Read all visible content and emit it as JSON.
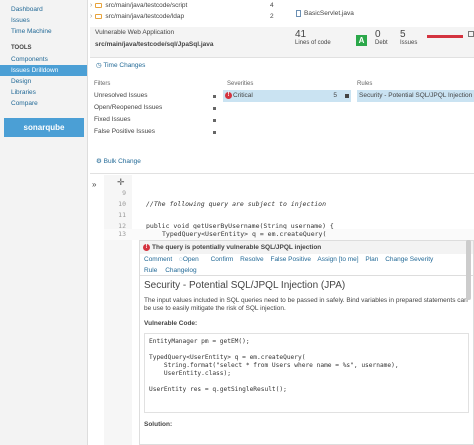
{
  "nav": {
    "items_top": [
      "Dashboard",
      "Issues",
      "Time Machine"
    ],
    "tools_heading": "TOOLS",
    "items_tools": [
      "Components",
      "Issues Drilldown",
      "Design",
      "Libraries",
      "Compare"
    ],
    "logo": "sonarqube"
  },
  "breadcrumb": {
    "rows": [
      {
        "path": "src/main/java/testcode/script",
        "count": "4"
      },
      {
        "path": "src/main/java/testcode/ldap",
        "count": "2"
      }
    ],
    "right_file": "BasicServlet.java"
  },
  "header": {
    "project": "Vulnerable Web Application",
    "file": "src/main/java/testcode/sql/JpaSql.java",
    "loc": "41",
    "loc_label": "Lines of code",
    "grade": "A",
    "debt": "0",
    "debt_label": "Debt",
    "issues": "5",
    "issues_label": "Issues",
    "colors": {
      "grade": "#2ba84a",
      "critical": "#d4333f",
      "link": "#236a97",
      "selected": "#cae3f2"
    }
  },
  "time_changes": "Time Changes",
  "filters": {
    "col1_head": "Filters",
    "col2_head": "Severities",
    "col3_head": "Rules",
    "rows": [
      "Unresolved Issues",
      "Open/Reopened Issues",
      "Fixed Issues",
      "False Positive Issues"
    ],
    "severity": "Critical",
    "severity_count": "5",
    "rule": "Security - Potential SQL/JPQL Injection"
  },
  "bulk_change": "Bulk Change",
  "code": {
    "lines": [
      {
        "num": "9",
        "text": ""
      },
      {
        "num": "10",
        "text": "//The following query are subject to injection"
      },
      {
        "num": "11",
        "text": ""
      },
      {
        "num": "12",
        "text": "public void getUserByUsername(String username) {"
      },
      {
        "num": "13",
        "text": "TypedQuery<UserEntity> q = em.createQuery("
      }
    ]
  },
  "issue": {
    "message": "The query is potentially vulnerable SQL/JPQL injection",
    "actions": [
      "Comment",
      "Open",
      "Confirm",
      "Resolve",
      "False Positive",
      "Assign [to me]",
      "Plan",
      "Change Severity"
    ],
    "tabs": [
      "Rule",
      "Changelog"
    ],
    "rule_title": "Security - Potential SQL/JPQL Injection (JPA)",
    "rule_desc": "The input values included in SQL queries need to be passed in safely. Bind variables in prepared statements can be use to easily mitigate the risk of SQL injection.",
    "vuln_label": "Vulnerable Code:",
    "vuln_code": "EntityManager pm = getEM();\n\nTypedQuery<UserEntity> q = em.createQuery(\n    String.format(\"select * from Users where name = %s\", username),\n    UserEntity.class);\n\nUserEntity res = q.getSingleResult();",
    "solution_label": "Solution:"
  }
}
